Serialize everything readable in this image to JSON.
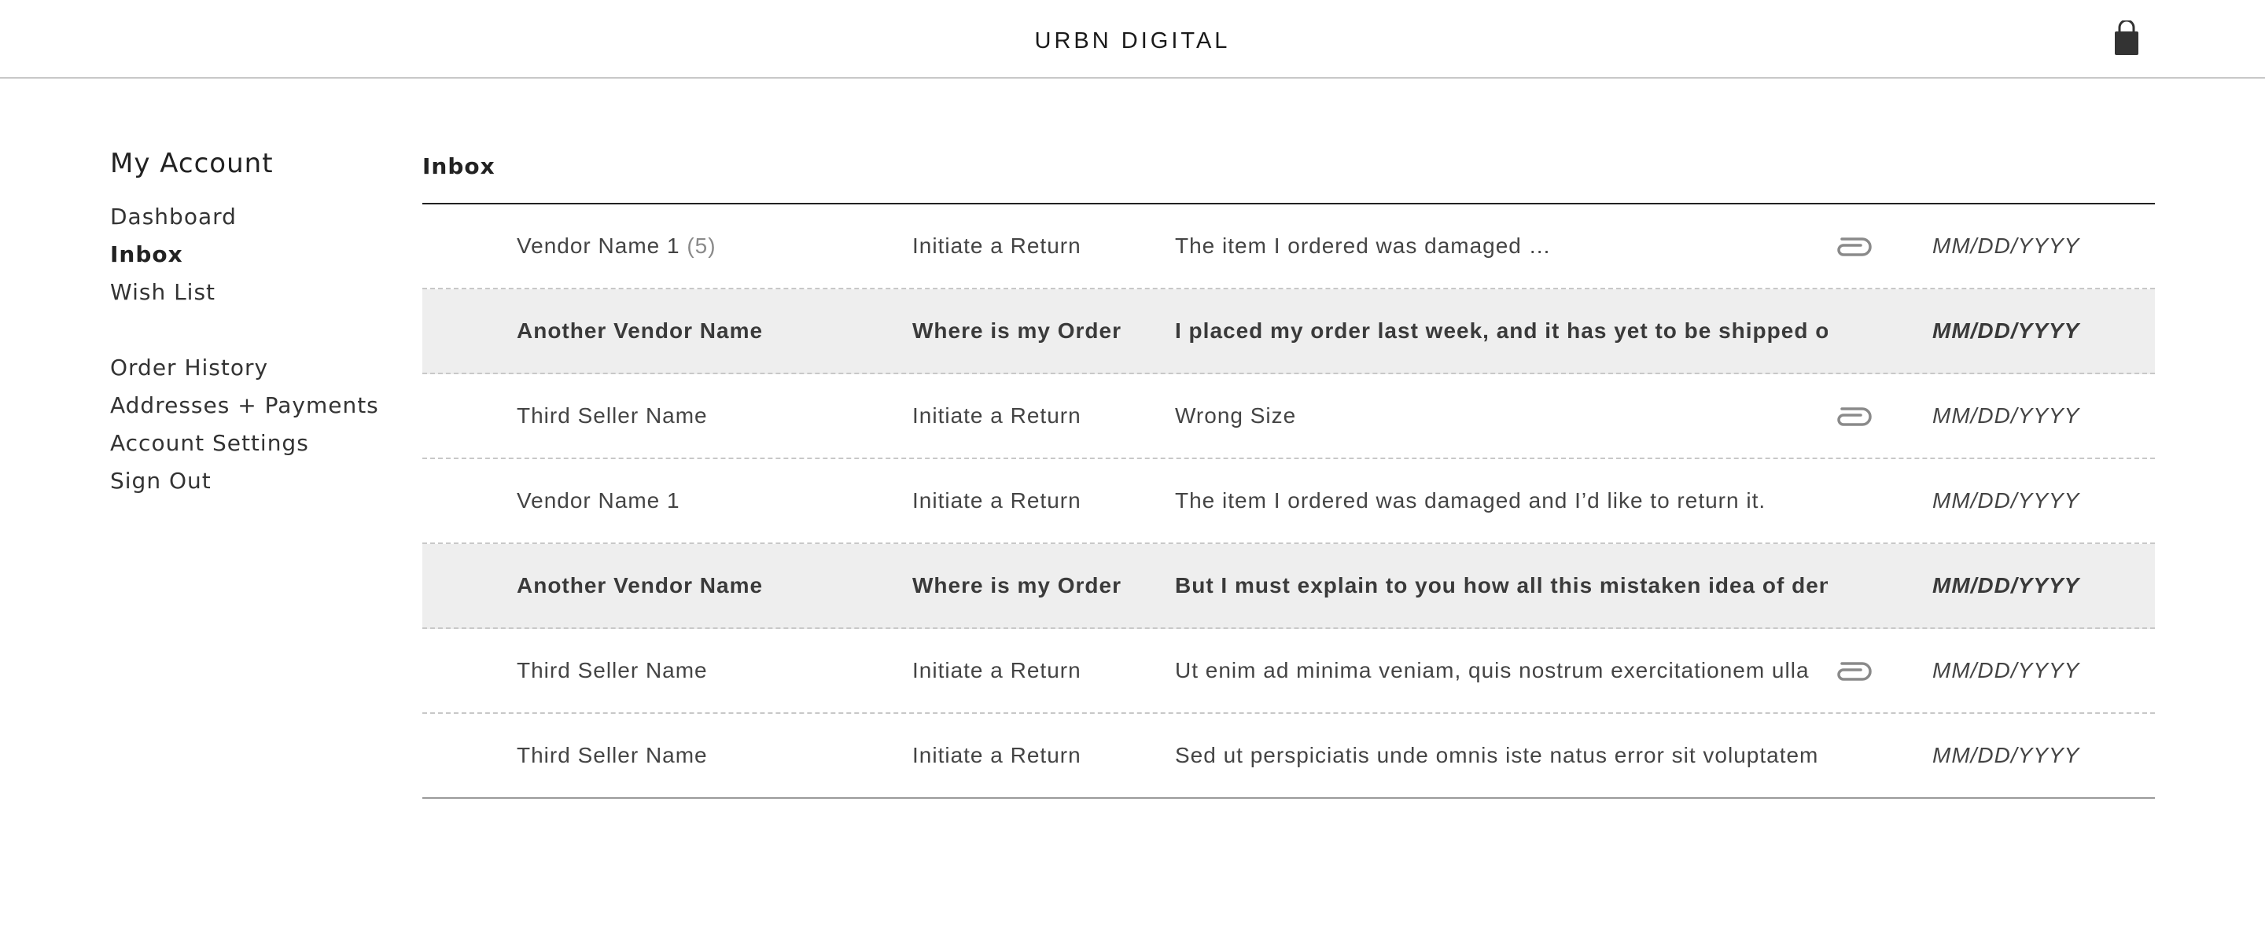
{
  "header": {
    "brand": "URBN DIGITAL",
    "cart_icon": "shopping-bag-icon"
  },
  "sidebar": {
    "title": "My Account",
    "group1": [
      {
        "label": "Dashboard",
        "active": false
      },
      {
        "label": "Inbox",
        "active": true
      },
      {
        "label": "Wish List",
        "active": false
      }
    ],
    "group2": [
      {
        "label": "Order History"
      },
      {
        "label": "Addresses + Payments"
      },
      {
        "label": "Account Settings"
      },
      {
        "label": "Sign Out"
      }
    ]
  },
  "inbox": {
    "title": "Inbox",
    "attachment_icon": "paperclip-icon",
    "rows": [
      {
        "vendor": "Vendor Name 1",
        "count": "(5)",
        "subject": "Initiate a Return",
        "message": "The item I ordered was damaged …",
        "attachment": true,
        "date": "MM/DD/YYYY",
        "unread": false
      },
      {
        "vendor": "Another Vendor Name",
        "count": "",
        "subject": "Where is my Order",
        "message": "I placed my order last week, and it has yet to be shipped o",
        "attachment": false,
        "date": "MM/DD/YYYY",
        "unread": true
      },
      {
        "vendor": "Third Seller Name",
        "count": "",
        "subject": "Initiate a Return",
        "message": "Wrong Size",
        "attachment": true,
        "date": "MM/DD/YYYY",
        "unread": false
      },
      {
        "vendor": "Vendor Name 1",
        "count": "",
        "subject": "Initiate a Return",
        "message": "The item I ordered was damaged and I’d like to return it.",
        "attachment": false,
        "date": "MM/DD/YYYY",
        "unread": false
      },
      {
        "vendor": "Another Vendor Name",
        "count": "",
        "subject": "Where is my Order",
        "message": "But I must explain to you how all this mistaken idea of den",
        "attachment": false,
        "date": "MM/DD/YYYY",
        "unread": true
      },
      {
        "vendor": "Third Seller Name",
        "count": "",
        "subject": "Initiate a Return",
        "message": "Ut enim ad minima veniam, quis nostrum exercitationem ulla",
        "attachment": true,
        "date": "MM/DD/YYYY",
        "unread": false
      },
      {
        "vendor": "Third Seller Name",
        "count": "",
        "subject": "Initiate a Return",
        "message": "Sed ut perspiciatis unde omnis iste natus error sit voluptatem",
        "attachment": false,
        "date": "MM/DD/YYYY",
        "unread": false
      }
    ]
  }
}
